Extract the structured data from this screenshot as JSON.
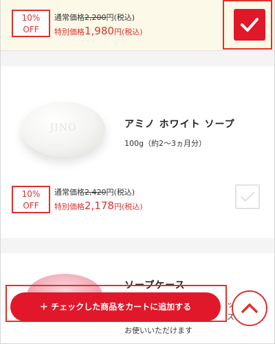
{
  "items": [
    {
      "discount_line1": "10%",
      "discount_line2": "OFF",
      "regular_label": "通常価格",
      "regular_price": "2,200",
      "regular_suffix": "円(税込)",
      "special_label": "特別価格",
      "special_price": "1,980",
      "special_suffix": "円(税込)",
      "checked": true
    },
    {
      "image_text": "JINO",
      "name": "アミノ ホワイト ソープ",
      "description": "100g（約2〜3ヵ月分）",
      "discount_line1": "10%",
      "discount_line2": "OFF",
      "regular_label": "通常価格",
      "regular_price": "2,420",
      "regular_suffix": "円(税込)",
      "special_label": "特別価格",
      "special_price": "2,178",
      "special_suffix": "円(税込)",
      "checked": false
    },
    {
      "name": "ソープケース",
      "partial_text_1": "ッ",
      "partial_text_2": "ズ",
      "description": "お使いいただけます"
    }
  ],
  "cart_button_label": "＋ チェックした商品をカートに追加する",
  "scroll_top_icon": "chevron-up-icon",
  "colors": {
    "accent": "#e0182a",
    "badge_red": "#e0302a",
    "selected_bg": "#fdf9e8",
    "divider": "#f4f4f4"
  }
}
